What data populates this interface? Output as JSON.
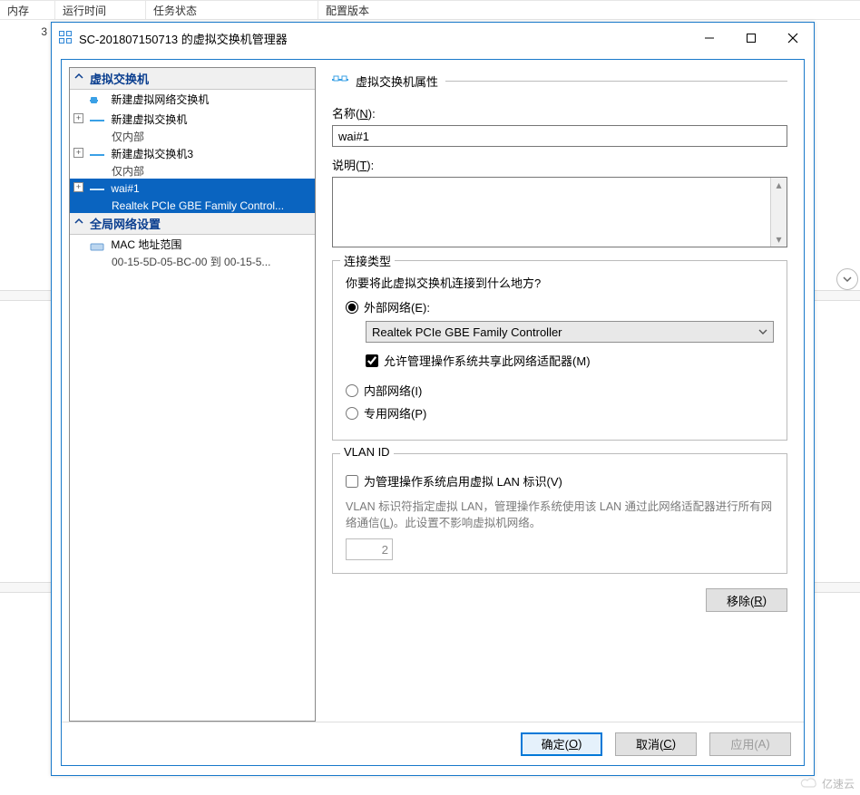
{
  "bg": {
    "headers": [
      "内存",
      "运行时间",
      "任务状态",
      "配置版本"
    ],
    "row0_cell0": "3"
  },
  "titlebar": {
    "title": "SC-201807150713 的虚拟交换机管理器"
  },
  "tree": {
    "section1": "虚拟交换机",
    "new_vsw": "新建虚拟网络交换机",
    "item1": {
      "name": "新建虚拟交换机",
      "sub": "仅内部"
    },
    "item2": {
      "name": "新建虚拟交换机3",
      "sub": "仅内部"
    },
    "item3": {
      "name": "wai#1",
      "sub": "Realtek PCIe GBE Family Control..."
    },
    "section2": "全局网络设置",
    "mac": {
      "name": "MAC 地址范围",
      "sub": "00-15-5D-05-BC-00 到 00-15-5..."
    }
  },
  "detail": {
    "header": "虚拟交换机属性",
    "name_label_pre": "名称(",
    "name_label_key": "N",
    "name_label_post": "):",
    "name_value": "wai#1",
    "desc_label_pre": "说明(",
    "desc_label_key": "T",
    "desc_label_post": "):",
    "desc_value": "",
    "conn_legend": "连接类型",
    "conn_question": "你要将此虚拟交换机连接到什么地方?",
    "radio_ext_pre": "外部网络(",
    "radio_ext_key": "E",
    "radio_ext_post": "):",
    "combo_value": "Realtek PCIe GBE Family Controller",
    "allow_share_pre": "允许管理操作系统共享此网络适配器(",
    "allow_share_key": "M",
    "allow_share_post": ")",
    "radio_int_pre": "内部网络(",
    "radio_int_key": "I",
    "radio_int_post": ")",
    "radio_priv_pre": "专用网络(",
    "radio_priv_key": "P",
    "radio_priv_post": ")",
    "vlan_legend": "VLAN ID",
    "vlan_check_pre": "为管理操作系统启用虚拟 LAN 标识(",
    "vlan_check_key": "V",
    "vlan_check_post": ")",
    "vlan_help_a": "VLAN 标识符指定虚拟 LAN，管理操作系统使用该 LAN 通过此网络适配器进行所有网络通信(",
    "vlan_help_key": "L",
    "vlan_help_b": ")。此设置不影响虚拟机网络。",
    "vlan_value": "2",
    "remove_pre": "移除(",
    "remove_key": "R",
    "remove_post": ")"
  },
  "buttons": {
    "ok_pre": "确定(",
    "ok_key": "O",
    "ok_post": ")",
    "cancel_pre": "取消(",
    "cancel_key": "C",
    "cancel_post": ")",
    "apply_pre": "应用(",
    "apply_key": "A",
    "apply_post": ")"
  },
  "watermark": "亿速云"
}
